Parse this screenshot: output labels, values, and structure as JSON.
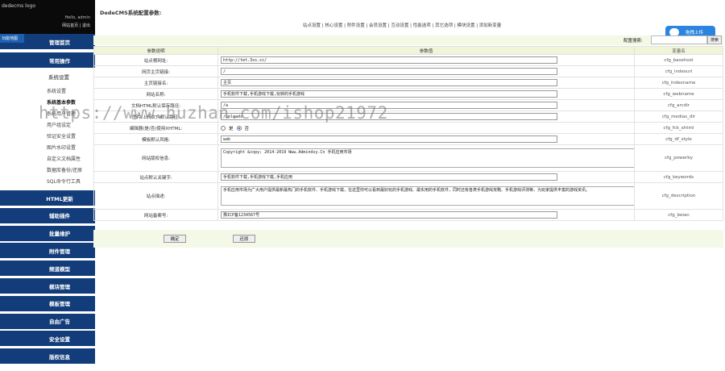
{
  "header": {
    "logo_text": "dedecms logo",
    "hello": "Hello, admin",
    "links": "网站首页 | 退出",
    "side_label": "功能地图"
  },
  "page": {
    "title": "DedeCMS系统配置参数:",
    "tabs": "站点设置 | 核心设置 | 附件设置 | 会员设置 | 互动设置 | 性能选项 | 其它选项 | 模块设置 | 添加新变量",
    "upload_label": "拖拽上传"
  },
  "sidebar": {
    "top": [
      {
        "label": "管理首页"
      },
      {
        "label": "常用操作"
      }
    ],
    "section": "系统设置",
    "subs": [
      {
        "label": "系统设置",
        "bold": false
      },
      {
        "label": "系统基本参数",
        "bold": true
      },
      {
        "label": "系统用户管理",
        "bold": false
      },
      {
        "label": "用户组设定",
        "bold": false
      },
      {
        "label": "验证安全设置",
        "bold": false
      },
      {
        "label": "图片水印设置",
        "bold": false
      },
      {
        "label": "自定义文档属性",
        "bold": false
      },
      {
        "label": "数据库备份/还原",
        "bold": false
      },
      {
        "label": "SQL命令行工具",
        "bold": false
      }
    ],
    "bottom": [
      {
        "label": "HTML更新"
      },
      {
        "label": "辅助插件"
      },
      {
        "label": "批量维护"
      },
      {
        "label": "附件管理"
      },
      {
        "label": "频道模型"
      },
      {
        "label": "模块管理"
      },
      {
        "label": "模板管理"
      },
      {
        "label": "自由广告"
      },
      {
        "label": "安全设置"
      },
      {
        "label": "版权信息"
      }
    ]
  },
  "search": {
    "label": "配置搜索:",
    "button": "搜索"
  },
  "table": {
    "headers": [
      "参数说明",
      "参数值",
      "变量名"
    ],
    "rows": [
      {
        "label": "站点根网址:",
        "value": "http://tet.3ss.cc/",
        "var": "cfg_basehost",
        "kind": "input"
      },
      {
        "label": "网页主页链接:",
        "value": "/",
        "var": "cfg_indexurl",
        "kind": "input"
      },
      {
        "label": "主页链接名:",
        "value": "主页",
        "var": "cfg_indexname",
        "kind": "input"
      },
      {
        "label": "网站名称:",
        "value": "手机软件下载,手机游戏下载,玩转的手机游戏",
        "var": "cfg_webname",
        "kind": "input"
      },
      {
        "label": "文档HTML默认保存路径:",
        "value": "/a",
        "var": "cfg_arcdir",
        "kind": "input"
      },
      {
        "label": "图片/上传文件默认路径:",
        "value": "/uploads",
        "var": "cfg_medias_dir",
        "kind": "input"
      },
      {
        "label": "编辑器(是/否)使用XHTML:",
        "value": "",
        "var": "cfg_fck_xhtml",
        "kind": "radio",
        "opt_yes": "是",
        "opt_no": "否"
      },
      {
        "label": "模板默认风格:",
        "value": "wab",
        "var": "cfg_df_style",
        "kind": "input"
      },
      {
        "label": "网站版权信息:",
        "value": "Copyright &copy; 2014-2019 Www.Admindsy.Cn 手机应用市场",
        "var": "cfg_powerby",
        "kind": "area"
      },
      {
        "label": "站点默认关键字:",
        "value": "手机软件下载,手机游戏下载,手机应用",
        "var": "cfg_keywords",
        "kind": "input"
      },
      {
        "label": "站点描述:",
        "value": "手机应用市场为广大用户提供最新最热门的手机软件、手机游戏下载，在这里你可以看到最好玩的手机游戏、最实用的手机软件，同时还有各类手机游戏攻略、手机游戏评测等，为玩家提供丰富的游戏资讯。",
        "var": "cfg_description",
        "kind": "area"
      },
      {
        "label": "网站备案号:",
        "value": "豫ICP备1234567号",
        "var": "cfg_beian",
        "kind": "input"
      }
    ]
  },
  "actions": {
    "confirm": "确定",
    "reset": "还原"
  },
  "watermark": "https://www.huzhan.com/ishop21972",
  "colors": {
    "nav_blue": "#123d7a",
    "header_green": "#eef5d9",
    "upload_blue": "#2a84e0"
  }
}
